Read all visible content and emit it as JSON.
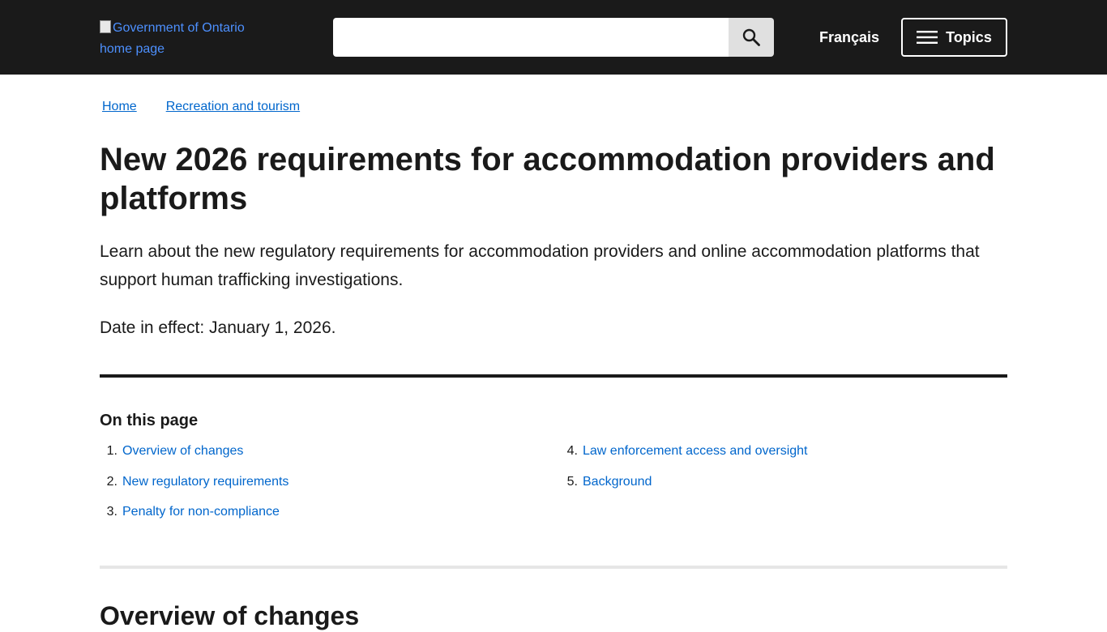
{
  "header": {
    "logo_alt": "Government of Ontario home page",
    "search": {
      "value": "",
      "placeholder": "",
      "button_icon": "search-icon"
    },
    "language_link": "Français",
    "topics_button": "Topics",
    "topics_icon": "menu-icon",
    "background_color": "#1a1a1a"
  },
  "breadcrumb": {
    "items": [
      {
        "label": "Home"
      },
      {
        "label": "Recreation and tourism"
      }
    ]
  },
  "page": {
    "title": "New 2026 requirements for accommodation providers and platforms",
    "intro": "Learn about the new regulatory requirements for accommodation providers and online accommodation platforms that support human trafficking investigations.",
    "effective_date": "Date in effect: January 1, 2026."
  },
  "on_this_page": {
    "heading": "On this page",
    "items": [
      {
        "number": "1.",
        "label": "Overview of changes"
      },
      {
        "number": "2.",
        "label": "New regulatory requirements"
      },
      {
        "number": "3.",
        "label": "Penalty for non-compliance"
      },
      {
        "number": "4.",
        "label": "Law enforcement access and oversight"
      },
      {
        "number": "5.",
        "label": "Background"
      }
    ]
  },
  "sections": [
    {
      "heading": "Overview of changes"
    }
  ],
  "colors": {
    "link": "#0066cc",
    "text": "#1a1a1a",
    "rule_light": "#e6e6e6"
  }
}
